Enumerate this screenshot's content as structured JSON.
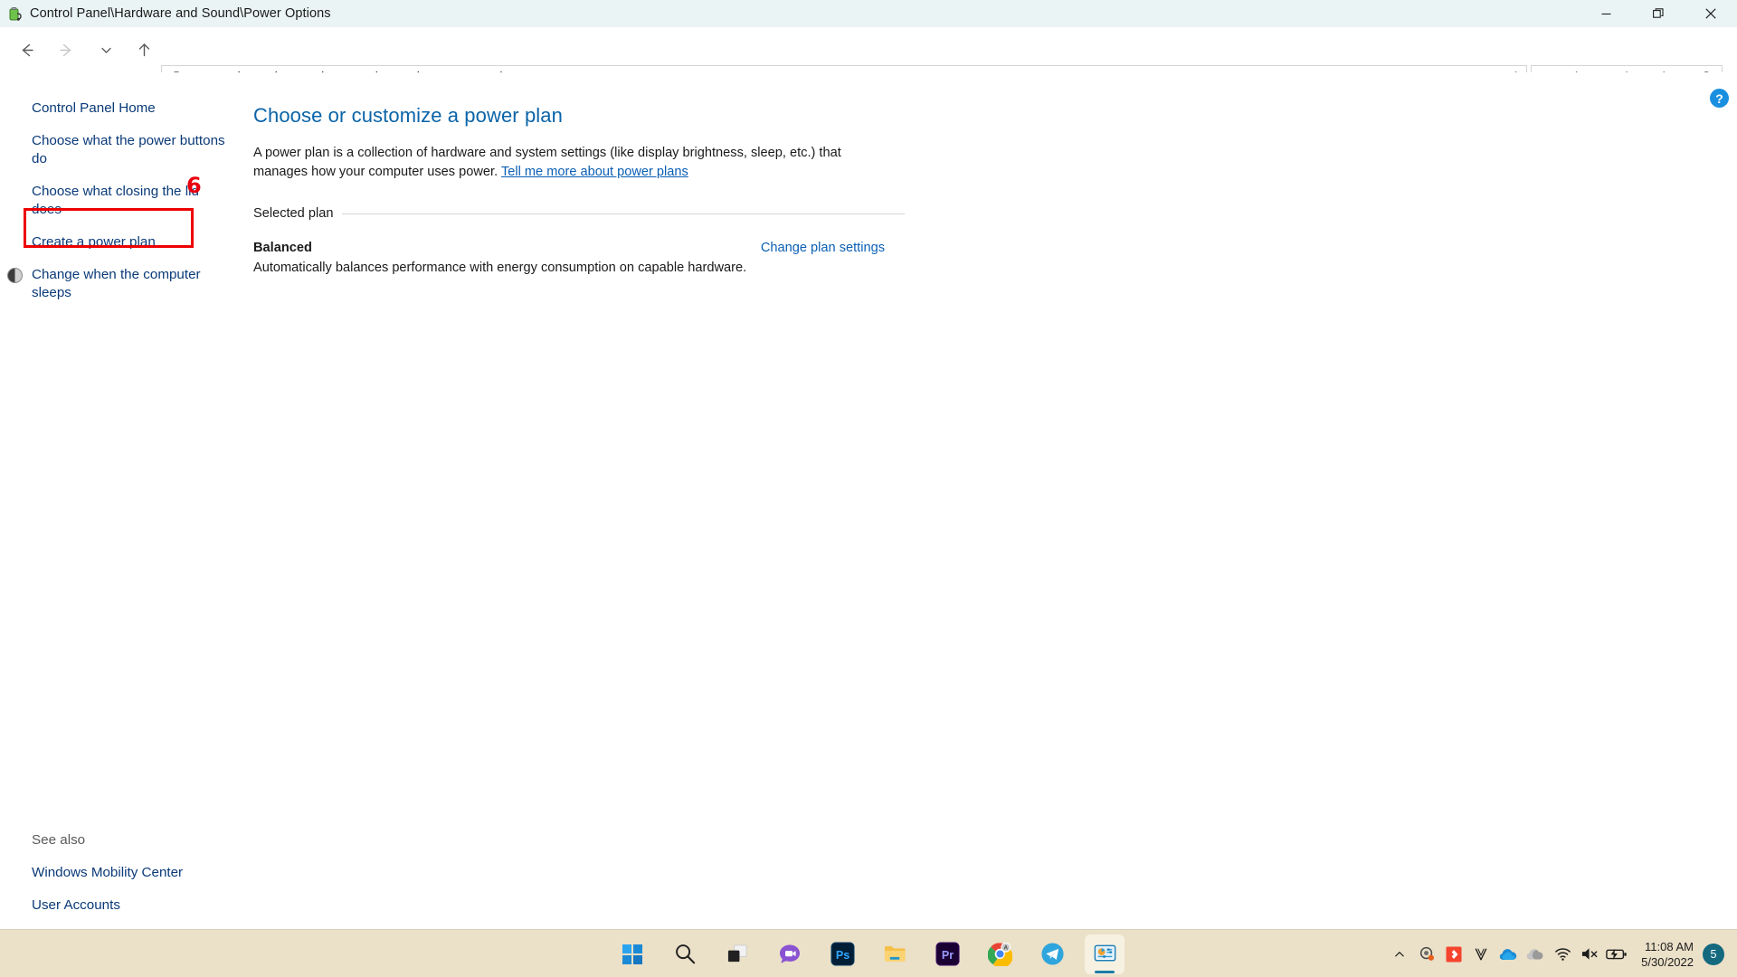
{
  "window": {
    "title": "Control Panel\\Hardware and Sound\\Power Options",
    "icon": "power-battery-icon",
    "controls": {
      "minimize": "—",
      "restore": "❐",
      "close": "✕"
    }
  },
  "nav": {
    "back": "←",
    "forward": "→",
    "recent": "⌄",
    "up": "↑",
    "breadcrumb": [
      "Control Panel",
      "Hardware and Sound",
      "Power Options"
    ],
    "separator": "›",
    "dropdown": "⌄",
    "refresh": "⟳"
  },
  "search": {
    "placeholder": "Search Control Panel",
    "value": "",
    "icon": "search-icon"
  },
  "help": {
    "label": "?"
  },
  "sidebar": {
    "home": "Control Panel Home",
    "items": [
      {
        "label": "Choose what the power buttons do",
        "has_uac_icon": false,
        "highlighted": true
      },
      {
        "label": "Choose what closing the lid does",
        "has_uac_icon": false,
        "highlighted": false
      },
      {
        "label": "Create a power plan",
        "has_uac_icon": false,
        "highlighted": false
      },
      {
        "label": "Change when the computer sleeps",
        "has_uac_icon": true,
        "highlighted": false
      }
    ],
    "see_also_title": "See also",
    "see_also": [
      "Windows Mobility Center",
      "User Accounts"
    ]
  },
  "annotation": {
    "number": "6",
    "color": "#ee0000"
  },
  "main": {
    "heading": "Choose or customize a power plan",
    "description": "A power plan is a collection of hardware and system settings (like display brightness, sleep, etc.) that manages how your computer uses power.",
    "description_link": "Tell me more about power plans",
    "group_label": "Selected plan",
    "plan_name": "Balanced",
    "plan_change_link": "Change plan settings",
    "plan_description": "Automatically balances performance with energy consumption on capable hardware."
  },
  "taskbar": {
    "items": [
      {
        "name": "start",
        "label": "Start",
        "running": false
      },
      {
        "name": "search",
        "label": "Search",
        "running": false
      },
      {
        "name": "task-view",
        "label": "Task View",
        "running": false
      },
      {
        "name": "chat",
        "label": "Chat",
        "running": true
      },
      {
        "name": "photoshop",
        "label": "Ps",
        "running": false
      },
      {
        "name": "file-explorer",
        "label": "File Explorer",
        "running": false
      },
      {
        "name": "premiere-pro",
        "label": "Pr",
        "running": false
      },
      {
        "name": "chrome",
        "label": "Google Chrome",
        "running": true
      },
      {
        "name": "telegram",
        "label": "Telegram",
        "running": true
      },
      {
        "name": "control-panel",
        "label": "Control Panel",
        "running": true,
        "active": true
      }
    ],
    "tray": {
      "overflow": "∧",
      "icons": [
        "headset-icon",
        "red-diamond-icon",
        "v-logo-icon",
        "onedrive-icon",
        "cloud-icon",
        "wifi-icon",
        "speaker-muted-icon",
        "battery-charging-icon"
      ],
      "time": "11:08 AM",
      "date": "5/30/2022",
      "notification_count": "5"
    }
  },
  "colors": {
    "titlebar": "#eaf4f4",
    "taskbar": "#ebe0c8",
    "link": "#0a3a78",
    "heading": "#0a64a8",
    "annotation": "#ee0000",
    "help": "#1a8fe0"
  }
}
